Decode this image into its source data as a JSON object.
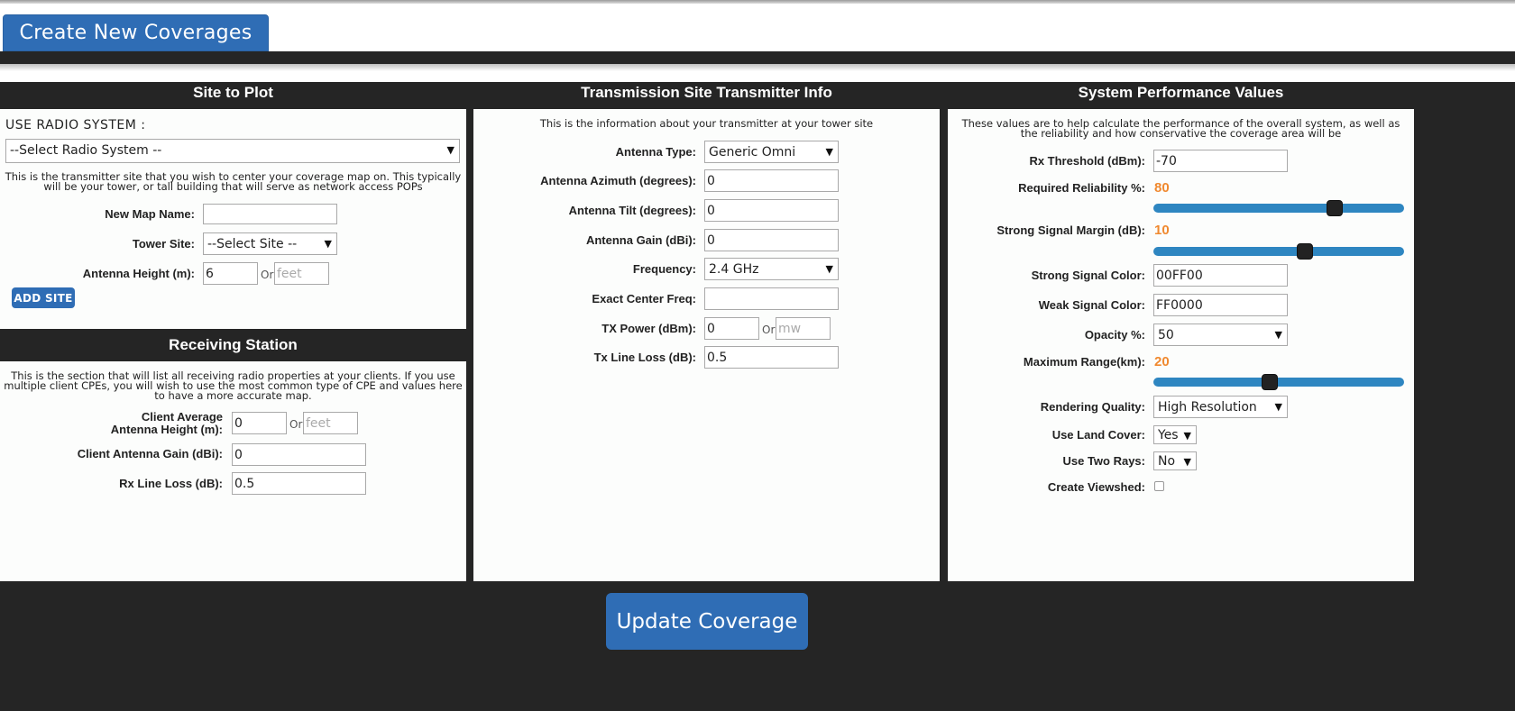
{
  "tab": {
    "label": "Create New Coverages"
  },
  "site_panel": {
    "title": "Site to Plot",
    "use_radio_label": "USE RADIO SYSTEM :",
    "radio_select": "--Select Radio System --",
    "description": "This is the transmitter site that you wish to center your coverage map on. This typically will be your tower, or tall building that will serve as network access POPs",
    "map_name_label": "New Map Name:",
    "map_name_value": "",
    "tower_site_label": "Tower Site:",
    "tower_site_select": "--Select Site --",
    "antenna_height_label": "Antenna Height (m):",
    "antenna_height_value": "6",
    "or_label": "Or",
    "feet_placeholder": "feet",
    "add_site_label": "ADD SITE"
  },
  "receiving_panel": {
    "title": "Receiving Station",
    "description": "This is the section that will list all receiving radio properties at your clients. If you use multiple client CPEs, you will wish to use the most common type of CPE and values here to have a more accurate map.",
    "client_height_label_1": "Client Average",
    "client_height_label_2": "Antenna Height (m):",
    "client_height_value": "0",
    "or_label": "Or",
    "feet_placeholder": "feet",
    "client_gain_label": "Client Antenna Gain (dBi):",
    "client_gain_value": "0",
    "rx_loss_label": "Rx Line Loss (dB):",
    "rx_loss_value": "0.5"
  },
  "transmitter_panel": {
    "title": "Transmission Site Transmitter Info",
    "description": "This is the information about your transmitter at your tower site",
    "antenna_type_label": "Antenna Type:",
    "antenna_type_value": "Generic Omni",
    "azimuth_label": "Antenna Azimuth (degrees):",
    "azimuth_value": "0",
    "tilt_label": "Antenna Tilt (degrees):",
    "tilt_value": "0",
    "gain_label": "Antenna Gain (dBi):",
    "gain_value": "0",
    "frequency_label": "Frequency:",
    "frequency_value": "2.4 GHz",
    "center_freq_label": "Exact Center Freq:",
    "center_freq_value": "",
    "tx_power_label": "TX Power (dBm):",
    "tx_power_value": "0",
    "or_label": "Or",
    "mw_placeholder": "mw",
    "tx_loss_label": "Tx Line Loss (dB):",
    "tx_loss_value": "0.5"
  },
  "performance_panel": {
    "title": "System Performance Values",
    "description": "These values are to help calculate the performance of the overall system, as well as the reliability and how conservative the coverage area will be",
    "rx_threshold_label": "Rx Threshold (dBm):",
    "rx_threshold_value": "-70",
    "reliability_label": "Required Reliability %:",
    "reliability_value": "80",
    "reliability_fraction": 0.74,
    "margin_label": "Strong Signal Margin (dB):",
    "margin_value": "10",
    "margin_fraction": 0.61,
    "strong_color_label": "Strong Signal Color:",
    "strong_color_value": "00FF00",
    "weak_color_label": "Weak Signal Color:",
    "weak_color_value": "FF0000",
    "opacity_label": "Opacity %:",
    "opacity_value": "50",
    "max_range_label": "Maximum Range(km):",
    "max_range_value": "20",
    "max_range_fraction": 0.46,
    "quality_label": "Rendering Quality:",
    "quality_value": "High Resolution",
    "land_cover_label": "Use Land Cover:",
    "land_cover_value": "Yes",
    "two_rays_label": "Use Two Rays:",
    "two_rays_value": "No",
    "viewshed_label": "Create Viewshed:",
    "viewshed_checked": false
  },
  "update_button_label": "Update Coverage",
  "colors": {
    "accent": "#2f6db5",
    "dark": "#252525",
    "slider": "#2e86c1",
    "highlight": "#f0892f"
  }
}
